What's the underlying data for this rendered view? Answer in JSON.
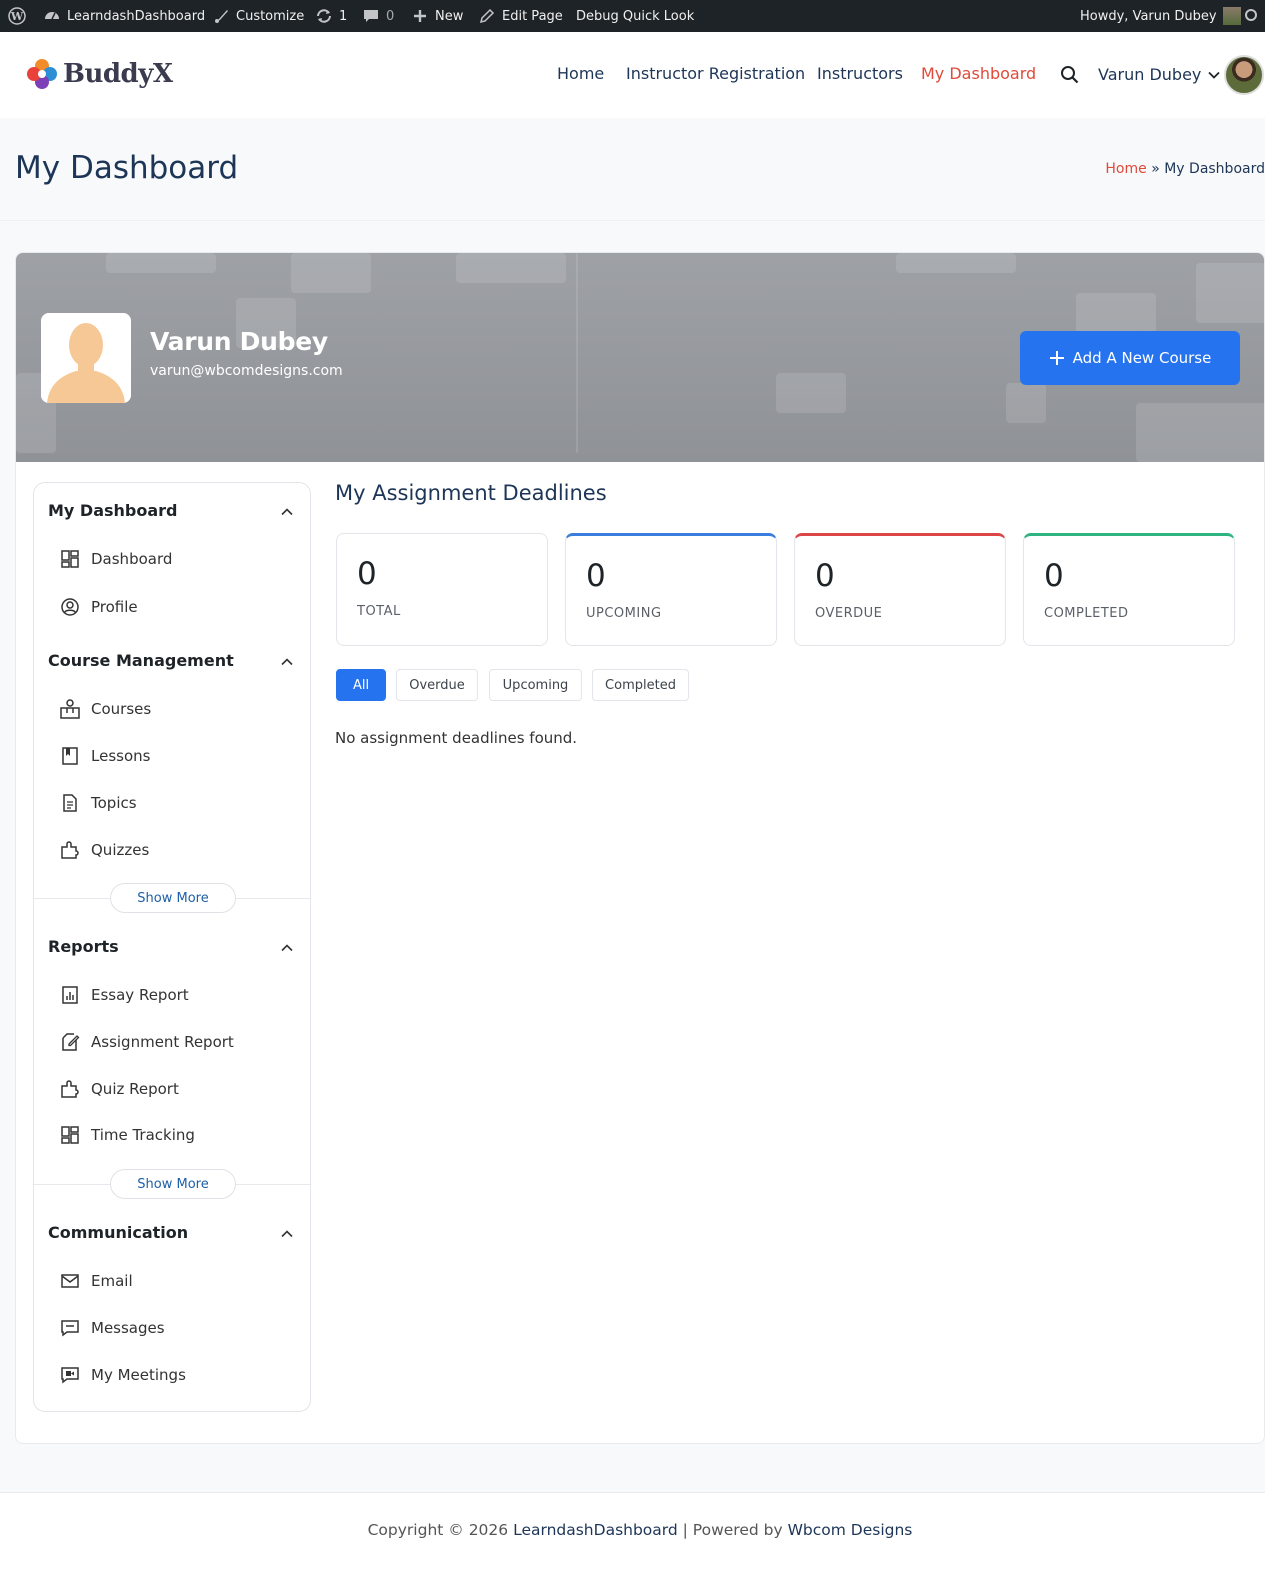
{
  "admin_bar": {
    "site_name": "LearndashDashboard",
    "customize": "Customize",
    "updates_count": "1",
    "comments_count": "0",
    "new_label": "New",
    "edit_page": "Edit Page",
    "debug": "Debug Quick Look",
    "howdy": "Howdy, Varun Dubey"
  },
  "header": {
    "logo_text": "BuddyX",
    "nav": [
      {
        "label": "Home"
      },
      {
        "label": "Instructor Registration"
      },
      {
        "label": "Instructors"
      },
      {
        "label": "My Dashboard",
        "active": true
      }
    ],
    "user_name": "Varun Dubey"
  },
  "page": {
    "title": "My Dashboard",
    "breadcrumb_home": "Home",
    "breadcrumb_sep": "»",
    "breadcrumb_current": "My Dashboard"
  },
  "profile": {
    "name": "Varun Dubey",
    "email": "varun@wbcomdesigns.com",
    "add_course": "Add A New Course"
  },
  "sidebar": {
    "sections": [
      {
        "title": "My Dashboard",
        "items": [
          {
            "label": "Dashboard",
            "icon": "grid-icon"
          },
          {
            "label": "Profile",
            "icon": "user-circle-icon"
          }
        ]
      },
      {
        "title": "Course Management",
        "items": [
          {
            "label": "Courses",
            "icon": "course-icon"
          },
          {
            "label": "Lessons",
            "icon": "bookmark-icon"
          },
          {
            "label": "Topics",
            "icon": "document-icon"
          },
          {
            "label": "Quizzes",
            "icon": "puzzle-icon"
          }
        ],
        "show_more": "Show More"
      },
      {
        "title": "Reports",
        "items": [
          {
            "label": "Essay Report",
            "icon": "chart-doc-icon"
          },
          {
            "label": "Assignment Report",
            "icon": "edit-doc-icon"
          },
          {
            "label": "Quiz Report",
            "icon": "puzzle-icon"
          },
          {
            "label": "Time Tracking",
            "icon": "grid-icon"
          }
        ],
        "show_more": "Show More"
      },
      {
        "title": "Communication",
        "items": [
          {
            "label": "Email",
            "icon": "mail-icon"
          },
          {
            "label": "Messages",
            "icon": "message-icon"
          },
          {
            "label": "My Meetings",
            "icon": "video-icon"
          }
        ]
      }
    ]
  },
  "content": {
    "title": "My Assignment Deadlines",
    "stats": [
      {
        "value": "0",
        "label": "TOTAL"
      },
      {
        "value": "0",
        "label": "UPCOMING",
        "color": "#3b7ddd"
      },
      {
        "value": "0",
        "label": "OVERDUE",
        "color": "#dc4646"
      },
      {
        "value": "0",
        "label": "COMPLETED",
        "color": "#2fb380"
      }
    ],
    "filters": [
      {
        "label": "All",
        "active": true
      },
      {
        "label": "Overdue"
      },
      {
        "label": "Upcoming"
      },
      {
        "label": "Completed"
      }
    ],
    "empty": "No assignment deadlines found."
  },
  "footer": {
    "prefix": "Copyright © 2026 ",
    "site": "LearndashDashboard",
    "mid": " | Powered by ",
    "company": "Wbcom Designs"
  }
}
